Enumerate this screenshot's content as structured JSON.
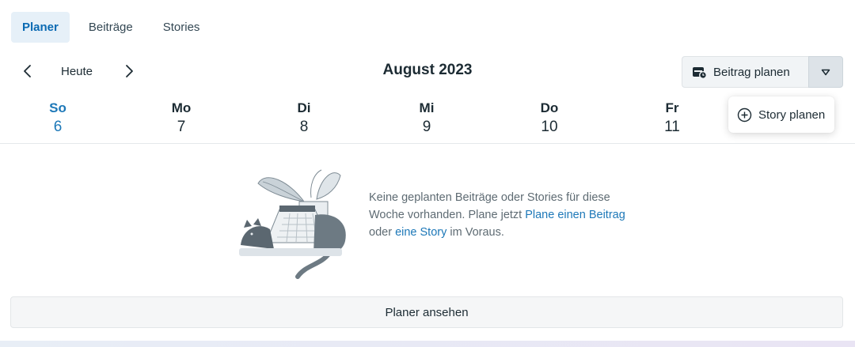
{
  "tabs": [
    {
      "label": "Planer",
      "active": true
    },
    {
      "label": "Beiträge",
      "active": false
    },
    {
      "label": "Stories",
      "active": false
    }
  ],
  "nav": {
    "today_label": "Heute",
    "month_title": "August 2023"
  },
  "actions": {
    "schedule_post_label": "Beitrag planen",
    "menu_items": [
      {
        "label": "Story planen",
        "icon": "plus-circle-icon"
      }
    ]
  },
  "week": {
    "days": [
      {
        "name": "So",
        "num": "6",
        "today": true
      },
      {
        "name": "Mo",
        "num": "7",
        "today": false
      },
      {
        "name": "Di",
        "num": "8",
        "today": false
      },
      {
        "name": "Mi",
        "num": "9",
        "today": false
      },
      {
        "name": "Do",
        "num": "10",
        "today": false
      },
      {
        "name": "Fr",
        "num": "11",
        "today": false
      }
    ]
  },
  "empty_state": {
    "text_1": "Keine geplanten Beiträge oder Stories für diese Woche vorhanden. Plane jetzt ",
    "link_post": "Plane einen Beitrag",
    "text_2": " oder ",
    "link_story": "eine Story",
    "text_3": " im Voraus."
  },
  "footer": {
    "view_planner_label": "Planer ansehen"
  },
  "colors": {
    "accent": "#1d78b8",
    "active_tab_bg": "#e6f0f8",
    "text": "#1c2b33"
  }
}
